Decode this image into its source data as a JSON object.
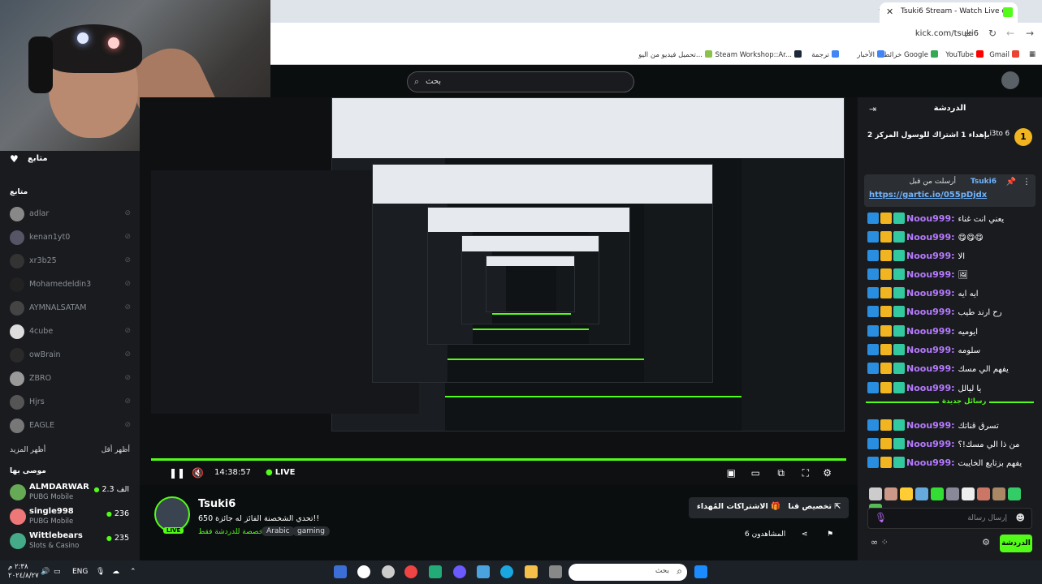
{
  "browser": {
    "tab_title": "Tsuki6 Stream - Watch Live on",
    "url": "kick.com/tsuki6",
    "bookmarks": [
      {
        "label": "Gmail",
        "color": "#ea4335"
      },
      {
        "label": "YouTube",
        "color": "#ff0000"
      },
      {
        "label": "خرائط Google",
        "color": "#34a853"
      },
      {
        "label": "الأخبار",
        "color": "#4285f4"
      },
      {
        "label": "ترجمة",
        "color": "#4285f4"
      },
      {
        "label": "Steam Workshop::Ar...",
        "color": "#1b2838"
      },
      {
        "label": "تحميل فيديو من اليو...",
        "color": "#8bc34a"
      }
    ]
  },
  "header": {
    "search_placeholder": "بحث"
  },
  "sidebar": {
    "title": "متابع",
    "following_label": "متابع",
    "channels": [
      "adlar",
      "kenan1yt0",
      "xr3b25",
      "Mohamedeldin3",
      "AYMNALSATAM",
      "4cube",
      "owBrain",
      "ZBRO",
      "Hjrs",
      "EAGLE"
    ],
    "show_more": "أظهر المزيد",
    "show_less": "أظهر أقل",
    "recommended_label": "موصى بها",
    "recommended": [
      {
        "name": "ALMDARWAR",
        "category": "PUBG Mobile",
        "viewers": "2.3 الف"
      },
      {
        "name": "single998",
        "category": "PUBG Mobile",
        "viewers": "236"
      },
      {
        "name": "Wittlebears",
        "category": "Slots & Casino",
        "viewers": "235"
      }
    ]
  },
  "player": {
    "time": "14:38:57",
    "live": "LIVE"
  },
  "stream": {
    "name": "Tsuki6",
    "title": "تحدي الشخصنة الفائز له جائزة 650!!",
    "category": "مخصصة للدردشة فقط",
    "tags": [
      "Arabic",
      "gaming"
    ],
    "live_badge": "LIVE",
    "btn_customize": "تخصيص قناتك",
    "btn_subscribe": "الاشتراكات المُهداء",
    "followers": "المشاهدون 6"
  },
  "chat": {
    "title": "الدردشة",
    "gift_text": "بإهداء 1 اشتراك للوسول المركز 2",
    "gift_user": "i3to",
    "gift_count": "6",
    "gift_rank": "1",
    "pinned_header": "أرسلت من قبل",
    "pinned_user": "Tsuki6",
    "pinned_link": "https://gartic.io/055pDjdx",
    "messages": [
      {
        "user": "Noou999:",
        "text": "يعني انت غناء"
      },
      {
        "user": "Noou999:",
        "text": "😋😋😋"
      },
      {
        "user": "Noou999:",
        "text": "الا"
      },
      {
        "user": "Noou999:",
        "text": "🖼"
      },
      {
        "user": "Noou999:",
        "text": "ايه ايه"
      },
      {
        "user": "Noou999:",
        "text": "رح ارند طيب"
      },
      {
        "user": "Noou999:",
        "text": "ايوميه"
      },
      {
        "user": "Noou999:",
        "text": "سلومه"
      },
      {
        "user": "Noou999:",
        "text": "يفهم الي مسك"
      },
      {
        "user": "Noou999:",
        "text": "يا ليالل"
      }
    ],
    "new_messages_label": "رسائل جديدة",
    "new_messages": [
      {
        "user": "Noou999:",
        "text": "تسرق قناتك"
      },
      {
        "user": "Noou999:",
        "text": "من ذا الي مسك!؟"
      },
      {
        "user": "Noou999:",
        "text": "يفهم بزتايع الخايبت"
      }
    ],
    "input_placeholder": "إرسال رسالة",
    "chat_button": "الدردشة"
  },
  "taskbar": {
    "search_placeholder": "بحث",
    "lang": "ENG",
    "time": "٢:٣٨ م",
    "date": "٢٠٢٤/٨/٢٧"
  }
}
